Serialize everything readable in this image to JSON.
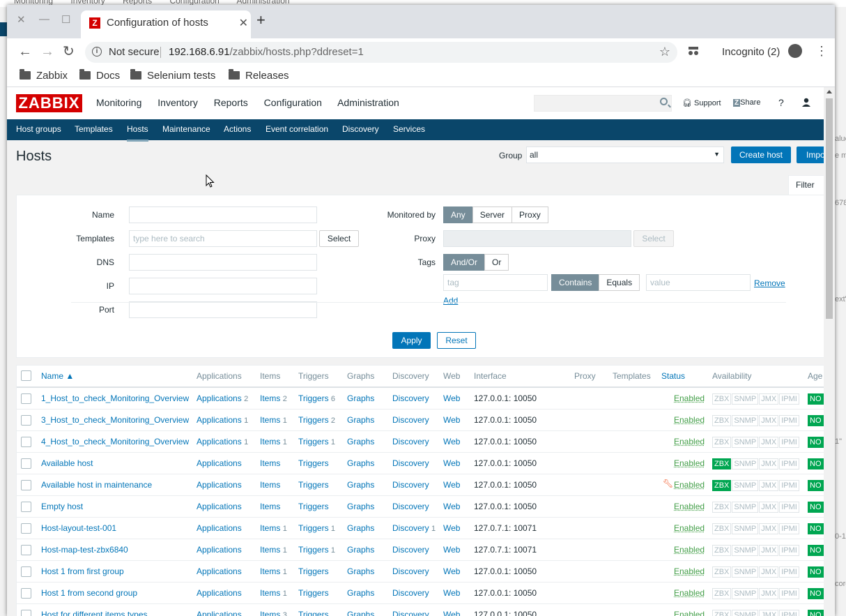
{
  "background": {
    "top_menu": [
      "Monitoring",
      "Inventory",
      "Reports",
      "Configuration",
      "Administration"
    ],
    "right_fragments": [
      "alue",
      "e ma",
      "678",
      "ext\"",
      "1\"",
      "0-1",
      "core"
    ]
  },
  "browser": {
    "tab_title": "Configuration of hosts",
    "tab_favicon": "Z",
    "omnibox": {
      "security": "Not secure",
      "host": "192.168.6.91",
      "path": "/zabbix/hosts.php?ddreset=1"
    },
    "incognito": "Incognito (2)",
    "bookmarks": [
      "Zabbix",
      "Docs",
      "Selenium tests",
      "Releases"
    ]
  },
  "zabbix": {
    "logo": "ZABBIX",
    "main_menu": [
      "Monitoring",
      "Inventory",
      "Reports",
      "Configuration",
      "Administration"
    ],
    "support": "Support",
    "share": "Share",
    "help": "?",
    "sub_menu": [
      "Host groups",
      "Templates",
      "Hosts",
      "Maintenance",
      "Actions",
      "Event correlation",
      "Discovery",
      "Services"
    ],
    "page_title": "Hosts",
    "group_label": "Group",
    "group_value": "all",
    "create_host": "Create host",
    "import": "Impo",
    "filter_tab": "Filter",
    "filter": {
      "name_label": "Name",
      "templates_label": "Templates",
      "templates_placeholder": "type here to search",
      "select": "Select",
      "dns_label": "DNS",
      "ip_label": "IP",
      "port_label": "Port",
      "monitored_by_label": "Monitored by",
      "monitored_by": [
        "Any",
        "Server",
        "Proxy"
      ],
      "proxy_label": "Proxy",
      "tags_label": "Tags",
      "tags_mode": [
        "And/Or",
        "Or"
      ],
      "tag_placeholder": "tag",
      "tag_op": [
        "Contains",
        "Equals"
      ],
      "value_placeholder": "value",
      "remove": "Remove",
      "add": "Add",
      "apply": "Apply",
      "reset": "Reset"
    },
    "columns": [
      "Name ▲",
      "Applications",
      "Items",
      "Triggers",
      "Graphs",
      "Discovery",
      "Web",
      "Interface",
      "Proxy",
      "Templates",
      "Status",
      "Availability",
      "Age"
    ],
    "avail_labels": [
      "ZBX",
      "SNMP",
      "JMX",
      "IPMI"
    ],
    "no_badge": "NO",
    "rows": [
      {
        "name": "1_Host_to_check_Monitoring_Overview",
        "apps": "2",
        "items": "2",
        "triggers": "6",
        "disc": "",
        "iface": "127.0.0.1: 10050",
        "status": "Enabled",
        "zbx": false,
        "maint": false
      },
      {
        "name": "3_Host_to_check_Monitoring_Overview",
        "apps": "1",
        "items": "1",
        "triggers": "2",
        "disc": "",
        "iface": "127.0.0.1: 10050",
        "status": "Enabled",
        "zbx": false,
        "maint": false
      },
      {
        "name": "4_Host_to_check_Monitoring_Overview",
        "apps": "1",
        "items": "1",
        "triggers": "1",
        "disc": "",
        "iface": "127.0.0.1: 10050",
        "status": "Enabled",
        "zbx": false,
        "maint": false
      },
      {
        "name": "Available host",
        "apps": "",
        "items": "",
        "triggers": "",
        "disc": "",
        "iface": "127.0.0.1: 10050",
        "status": "Enabled",
        "zbx": true,
        "maint": false
      },
      {
        "name": "Available host in maintenance",
        "apps": "",
        "items": "",
        "triggers": "",
        "disc": "",
        "iface": "127.0.0.1: 10050",
        "status": "Enabled",
        "zbx": true,
        "maint": true
      },
      {
        "name": "Empty host",
        "apps": "",
        "items": "",
        "triggers": "",
        "disc": "",
        "iface": "127.0.0.1: 10050",
        "status": "Enabled",
        "zbx": false,
        "maint": false
      },
      {
        "name": "Host-layout-test-001",
        "apps": "",
        "items": "1",
        "triggers": "1",
        "disc": "1",
        "iface": "127.0.7.1: 10071",
        "status": "Enabled",
        "zbx": false,
        "maint": false
      },
      {
        "name": "Host-map-test-zbx6840",
        "apps": "",
        "items": "1",
        "triggers": "1",
        "disc": "",
        "iface": "127.0.7.1: 10071",
        "status": "Enabled",
        "zbx": false,
        "maint": false
      },
      {
        "name": "Host 1 from first group",
        "apps": "",
        "items": "1",
        "triggers": "",
        "disc": "",
        "iface": "127.0.0.1: 10050",
        "status": "Enabled",
        "zbx": false,
        "maint": false
      },
      {
        "name": "Host 1 from second group",
        "apps": "",
        "items": "1",
        "triggers": "",
        "disc": "",
        "iface": "127.0.0.1: 10050",
        "status": "Enabled",
        "zbx": false,
        "maint": false
      },
      {
        "name": "Host for different items types",
        "apps": "",
        "items": "3",
        "triggers": "",
        "disc": "",
        "iface": "127.0.0.1: 10050",
        "status": "Enabled",
        "zbx": false,
        "maint": false
      }
    ]
  }
}
